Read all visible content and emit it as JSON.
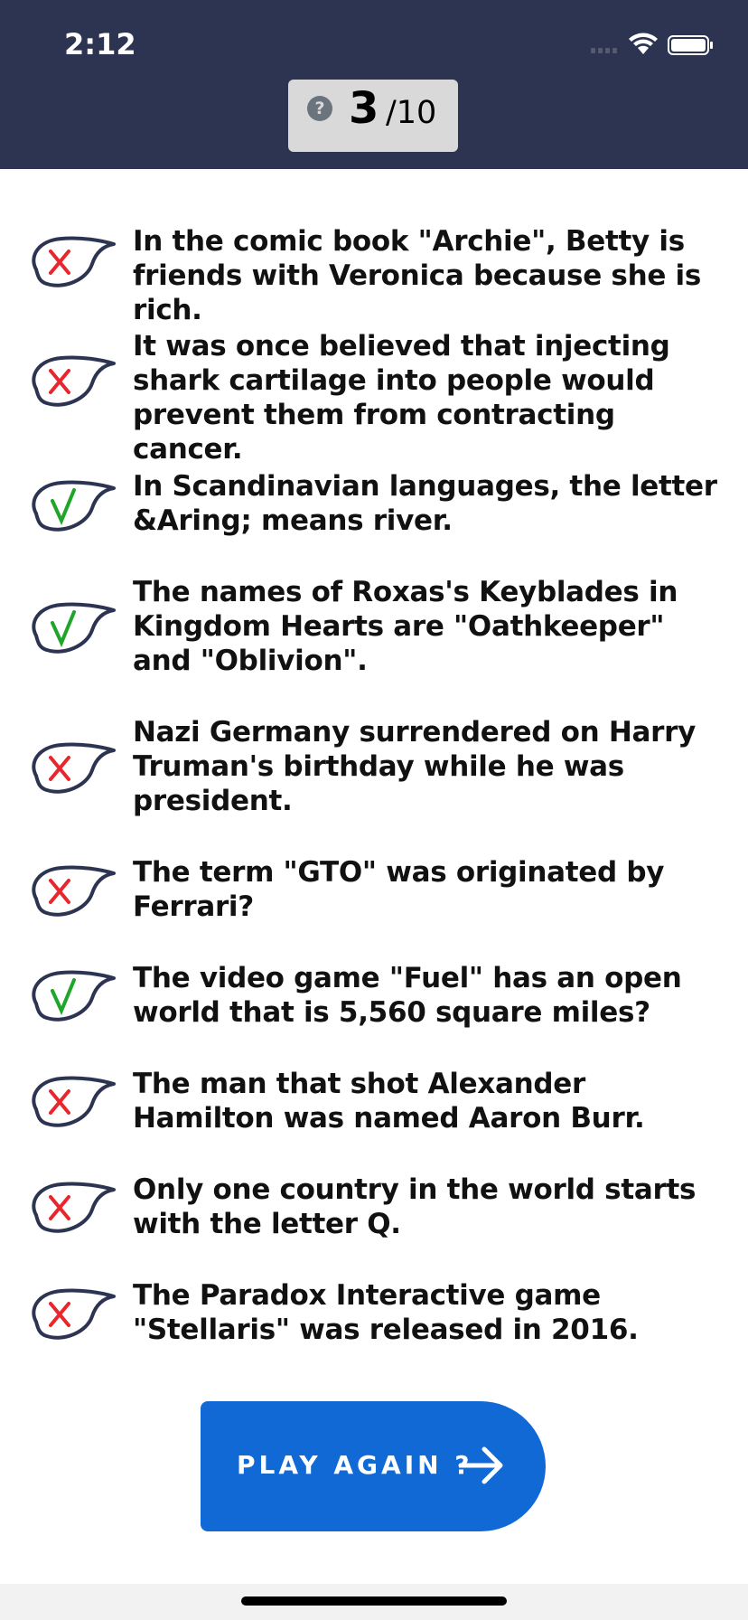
{
  "status_bar": {
    "time": "2:12"
  },
  "score": {
    "help_symbol": "?",
    "current": "3",
    "total": "/10"
  },
  "results": [
    {
      "text": "In the comic book \"Archie\", Betty is friends with Veronica because she is rich.",
      "correct": false
    },
    {
      "text": "It was once believed that injecting shark cartilage into people would prevent them from contracting cancer.",
      "correct": false
    },
    {
      "text": "In Scandinavian languages, the letter &Aring; means river.",
      "correct": true
    },
    {
      "text": "The names of Roxas's Keyblades in Kingdom Hearts are \"Oathkeeper\" and \"Oblivion\".",
      "correct": true
    },
    {
      "text": "Nazi Germany surrendered on Harry Truman's birthday while he was president.",
      "correct": false
    },
    {
      "text": "The term \"GTO\" was originated by Ferrari?",
      "correct": false
    },
    {
      "text": "The video game \"Fuel\" has an open world that is 5,560 square miles?",
      "correct": true
    },
    {
      "text": "The man that shot Alexander Hamilton was named Aaron Burr.",
      "correct": false
    },
    {
      "text": "Only one country in the world starts with the letter Q.",
      "correct": false
    },
    {
      "text": "The Paradox Interactive game \"Stellaris\" was released in 2016.",
      "correct": false
    }
  ],
  "play_again": {
    "label": "PLAY AGAIN ?"
  },
  "colors": {
    "header": "#2d3452",
    "button": "#1169d6",
    "wrong": "#e8262b",
    "right": "#1fa52a",
    "bubble": "#2d3452"
  }
}
